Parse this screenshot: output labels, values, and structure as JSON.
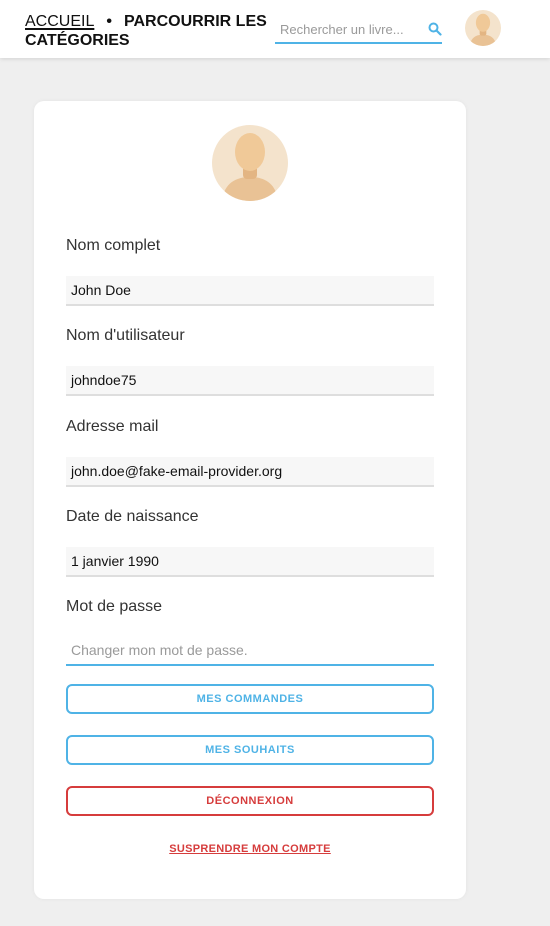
{
  "header": {
    "home_label": "ACCUEIL",
    "separator": "•",
    "categories_label": "PARCOURRIR LES CATÉGORIES",
    "search": {
      "placeholder": "Rechercher un livre..."
    }
  },
  "profile": {
    "fields": [
      {
        "label": "Nom complet",
        "value": "John Doe"
      },
      {
        "label": "Nom d'utilisateur",
        "value": "johndoe75"
      },
      {
        "label": "Adresse mail",
        "value": "john.doe@fake-email-provider.org"
      },
      {
        "label": "Date de naissance",
        "value": "1 janvier 1990"
      }
    ],
    "password": {
      "label": "Mot de passe",
      "placeholder": "Changer mon mot de passe."
    }
  },
  "actions": {
    "orders": "MES COMMANDES",
    "wishlist": "MES SOUHAITS",
    "logout": "DÉCONNEXION",
    "suspend": "SUSPRENDRE MON COMPTE"
  },
  "colors": {
    "accent": "#4fb3e6",
    "danger": "#d63c3c",
    "avatar_bg": "#f4e3cc",
    "skin": "#f0c998"
  },
  "icons": {
    "search": "search-icon",
    "avatar": "user-avatar-icon"
  }
}
